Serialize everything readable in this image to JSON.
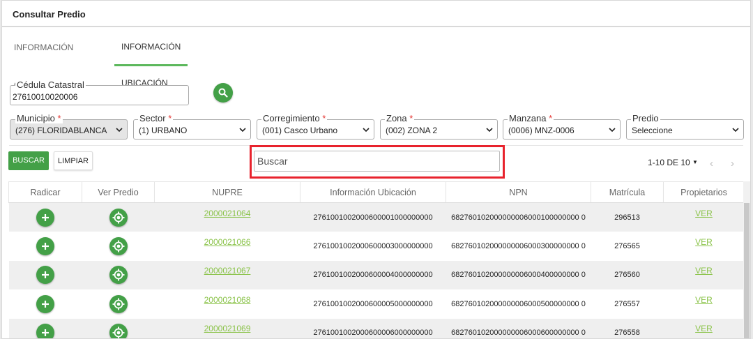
{
  "header": {
    "title": "Consultar Predio"
  },
  "tabs": [
    {
      "label": "INFORMACIÓN GENERAL"
    },
    {
      "label": "INFORMACIÓN UBICACIÓN",
      "active": true
    }
  ],
  "cedula": {
    "label": "Cédula Catastral",
    "value": "27610010020006"
  },
  "filters": {
    "municipio": {
      "label": "Municipio",
      "required": "*",
      "value": "(276) FLORIDABLANCA"
    },
    "sector": {
      "label": "Sector",
      "required": "*",
      "value": "(1) URBANO"
    },
    "corregimiento": {
      "label": "Corregimiento",
      "required": "*",
      "value": "(001) Casco Urbano"
    },
    "zona": {
      "label": "Zona",
      "required": "*",
      "value": "(002) ZONA 2"
    },
    "manzana": {
      "label": "Manzana",
      "required": "*",
      "value": "(0006) MNZ-0006"
    },
    "predio": {
      "label": "Predio",
      "value": "Seleccione"
    }
  },
  "actions": {
    "buscar": "BUSCAR",
    "limpiar": "LIMPIAR"
  },
  "search": {
    "placeholder": "Buscar"
  },
  "pager": {
    "text": "1-10 DE 10",
    "prev": "‹",
    "next": "›"
  },
  "table": {
    "columns": [
      "Radicar",
      "Ver Predio",
      "NUPRE",
      "Información Ubicación",
      "NPN",
      "Matrícula",
      "Propietarios"
    ],
    "rows": [
      {
        "nupre": "2000021064",
        "ubicacion": "2761001002000600001000000000",
        "npn": "682760102000000006000100000000 0",
        "matricula": "296513",
        "propietarios": "VER"
      },
      {
        "nupre": "2000021066",
        "ubicacion": "2761001002000600003000000000",
        "npn": "682760102000000006000300000000 0",
        "matricula": "276565",
        "propietarios": "VER"
      },
      {
        "nupre": "2000021067",
        "ubicacion": "2761001002000600004000000000",
        "npn": "682760102000000006000400000000 0",
        "matricula": "276560",
        "propietarios": "VER"
      },
      {
        "nupre": "2000021068",
        "ubicacion": "2761001002000600005000000000",
        "npn": "682760102000000006000500000000 0",
        "matricula": "276557",
        "propietarios": "VER"
      },
      {
        "nupre": "2000021069",
        "ubicacion": "2761001002000600006000000000",
        "npn": "682760102000000006000600000000 0",
        "matricula": "276558",
        "propietarios": "VER"
      }
    ]
  },
  "colors": {
    "accent": "#43a047",
    "link": "#8bc34a",
    "highlight": "#e8232d"
  }
}
